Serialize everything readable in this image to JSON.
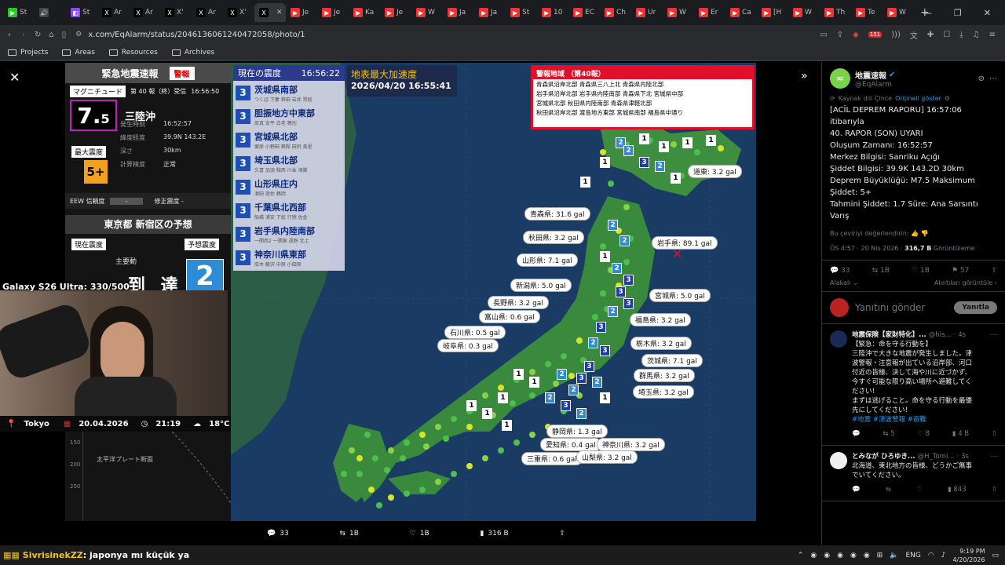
{
  "browser": {
    "tabs": [
      {
        "label": "St",
        "icon": "green"
      },
      {
        "label": "",
        "icon": "speaker"
      },
      {
        "label": "St",
        "icon": "twitch"
      },
      {
        "label": "Ar",
        "icon": "x"
      },
      {
        "label": "Ar",
        "icon": "x"
      },
      {
        "label": "X'",
        "icon": "x"
      },
      {
        "label": "Ar",
        "icon": "x"
      },
      {
        "label": "X'",
        "icon": "x"
      },
      {
        "label": "",
        "icon": "x"
      },
      {
        "label": "Je",
        "icon": "yt"
      },
      {
        "label": "Je",
        "icon": "yt"
      },
      {
        "label": "Ka",
        "icon": "yt"
      },
      {
        "label": "Je",
        "icon": "yt"
      },
      {
        "label": "W",
        "icon": "yt"
      },
      {
        "label": "Ja",
        "icon": "yt"
      },
      {
        "label": "Ja",
        "icon": "yt"
      },
      {
        "label": "St",
        "icon": "yt"
      },
      {
        "label": "10",
        "icon": "yt"
      },
      {
        "label": "EC",
        "icon": "yt"
      },
      {
        "label": "Ch",
        "icon": "yt"
      },
      {
        "label": "Ur",
        "icon": "yt"
      },
      {
        "label": "W",
        "icon": "yt"
      },
      {
        "label": "Er",
        "icon": "yt"
      },
      {
        "label": "Ca",
        "icon": "yt"
      },
      {
        "label": "[H",
        "icon": "yt"
      },
      {
        "label": "W",
        "icon": "yt"
      },
      {
        "label": "Th",
        "icon": "yt"
      },
      {
        "label": "Te",
        "icon": "yt"
      },
      {
        "label": "W",
        "icon": "yt"
      }
    ],
    "url": "x.com/EqAlarm/status/2046136061240472058/photo/1",
    "bookmarks": [
      "Projects",
      "Areas",
      "Resources",
      "Archives"
    ],
    "brave_badge": "151"
  },
  "eew": {
    "title": "緊急地震速報",
    "badge": "警報",
    "magnitude_label": "マグニチュード",
    "report": "第 40 報（終）受信",
    "report_time": "16:56:50",
    "magnitude": "7.",
    "magnitude_decimal": "5",
    "epicenter": "三陸沖",
    "origin_label": "発生時刻",
    "origin_time": "16:52:57",
    "latlon_label": "緯度経度",
    "latlon": "39.9N 143.2E",
    "depth_label": "深さ",
    "depth": "30km",
    "calc_label": "計算精度",
    "calc": "正常",
    "maxint_label": "最大震度",
    "maxint": "5+",
    "eew_reliability_label": "EEW 信頼度",
    "eew_reliability": "-",
    "correction_label": "修正震度 -",
    "forecast_title": "東京都 新宿区の予想",
    "current_int_label": "現在震度",
    "forecast_int_label": "予想震度",
    "main_shock_label": "主要動",
    "arrival": "到 達",
    "forecast_int": "2",
    "plate_label": "太平洋プレート断面",
    "depth_axis": [
      "150",
      "200",
      "250"
    ]
  },
  "current_intensity": {
    "title": "現在の震度",
    "time": "16:56:22",
    "stations": [
      {
        "int": "3",
        "region": "茨城県南部",
        "sub": "つくば 下妻 鉾田 岩井 常総"
      },
      {
        "int": "3",
        "region": "胆振地方中東部",
        "sub": "厚真 安平 白老 穂別"
      },
      {
        "int": "3",
        "region": "宮城県北部",
        "sub": "栗原 小野田 築館 田尻 美里"
      },
      {
        "int": "3",
        "region": "埼玉県北部",
        "sub": "久喜 加須 騎西 川本 鴻巣"
      },
      {
        "int": "3",
        "region": "山形県庄内",
        "sub": "酒田 遊佐 鶴岡"
      },
      {
        "int": "3",
        "region": "千葉県北西部",
        "sub": "船橋 浦安 下総 行徳 佐倉"
      },
      {
        "int": "3",
        "region": "岩手県内陸南部",
        "sub": "一関西2 一関東 遠野 北上"
      },
      {
        "int": "3",
        "region": "神奈川県東部",
        "sub": "厚木 藤沢 中原 小田原"
      }
    ]
  },
  "map": {
    "pga_title": "地表最大加速度",
    "pga_time": "2026/04/20 16:55:41",
    "warn_title": "警報地域 （第40報）",
    "warn_lines": [
      "青森県沿岸北部  青森県三八上北  青森県内陸北部",
      "岩手県沿岸北部  岩手県内陸南部  青森県下北  宮城県中部",
      "宮城県北部  秋田県内陸南部  青森県津軽北部",
      "秋田県沿岸北部  渡島地方東部  宮城県南部  福島県中通り"
    ],
    "labels": [
      {
        "t": "道東: 3.2 gal"
      },
      {
        "t": "青森県: 31.6 gal"
      },
      {
        "t": "秋田県: 3.2 gal"
      },
      {
        "t": "岩手県: 89.1 gal"
      },
      {
        "t": "山形県: 7.1 gal"
      },
      {
        "t": "新潟県: 5.0 gal"
      },
      {
        "t": "宮城県: 5.0 gal"
      },
      {
        "t": "長野県: 3.2 gal"
      },
      {
        "t": "福島県: 3.2 gal"
      },
      {
        "t": "富山県: 0.6 gal"
      },
      {
        "t": "石川県: 0.5 gal"
      },
      {
        "t": "栃木県: 3.2 gal"
      },
      {
        "t": "岐阜県: 0.3 gal"
      },
      {
        "t": "茨城県: 7.1 gal"
      },
      {
        "t": "群馬県: 3.2 gal"
      },
      {
        "t": "埼玉県: 3.2 gal"
      },
      {
        "t": "静岡県: 1.3 gal"
      },
      {
        "t": "愛知県: 0.4 gal"
      },
      {
        "t": "神奈川県: 3.2 gal"
      },
      {
        "t": "三重県: 0.6 gal"
      },
      {
        "t": "山梨県: 3.2 gal"
      }
    ]
  },
  "stream": {
    "overlay_title": "Galaxy S26 Ultra: 330/500",
    "city": "Tokyo",
    "date": "20.04.2026",
    "time": "21:19",
    "temp": "18°C",
    "chat_user": "SivrisinekZZ",
    "chat_msg": ": japonya mı küçük ya"
  },
  "viewer_actions": {
    "replies": "33",
    "reposts": "1B",
    "likes": "1B",
    "views": "316 B"
  },
  "post": {
    "author": "地震速報",
    "handle": "@EqAlarm",
    "source_lang": "Kaynak dili Çince",
    "show_original": "Orijinali göster",
    "text_lines": [
      "[ACİL DEPREM RAPORU] 16:57:06",
      "itibarıyla",
      "40. RAPOR (SON) UYARI",
      "Oluşum Zamanı: 16:52:57",
      "Merkez Bilgisi: Sanriku Açığı",
      "Şiddet Bilgisi: 39.9K 143.2D 30km",
      "Deprem Büyüklüğü: M7.5 Maksimum",
      "Şiddet: 5+",
      "Tahmini Şiddet: 1.7 Süre: Ana Sarsıntı",
      "Varış"
    ],
    "rate_translation": "Bu çeviriyi değerlendirin:",
    "timestamp": "ÖS 4:57 · 20 Nis 2026 · ",
    "views": "316,7 B",
    "views_label": " Görüntüleme",
    "replies": "33",
    "reposts": "1B",
    "likes": "1B",
    "bookmarks": "57",
    "sort_label": "Alakalı",
    "quotes_label": "Alıntıları görüntüle",
    "reply_placeholder": "Yanıtını gönder",
    "reply_button": "Yanıtla"
  },
  "replies": [
    {
      "name": "地震保険【家財特化】...",
      "handle": "@his...",
      "time": "4s",
      "lines": [
        "【緊急：命を守る行動を】",
        "三陸沖で大きな地震が発生しました。津",
        "波警報・注意報が出ている沿岸部、河口",
        "付近の皆様、決して海や川に近づかず、",
        "今すぐ可能な限り高い場所へ避難してく",
        "ださい！",
        "まずは逃げること。命を守る行動を最優",
        "先にしてください！"
      ],
      "tags": "#地震 #津波警報 #避難",
      "replies": "",
      "reposts": "5",
      "likes": "8",
      "views": "4 B"
    },
    {
      "name": "とみなが ひろゆき...",
      "handle": "@H_Tomi...",
      "time": "3s",
      "lines": [
        "北海道、東北地方の皆様、どうかご無事",
        "でいてください。"
      ],
      "tags": "",
      "replies": "",
      "reposts": "",
      "likes": "",
      "views": "843"
    }
  ],
  "taskbar": {
    "lang": "ENG",
    "time": "9:19 PM",
    "date": "4/20/2026"
  },
  "colors": {
    "twitter_blue": "#1d9bf0",
    "warn_red": "#e0102a",
    "int3": "#1c3fb0",
    "int2": "#2e8bd6",
    "sea": "#1a3b63",
    "land": "#3a8a3e"
  }
}
